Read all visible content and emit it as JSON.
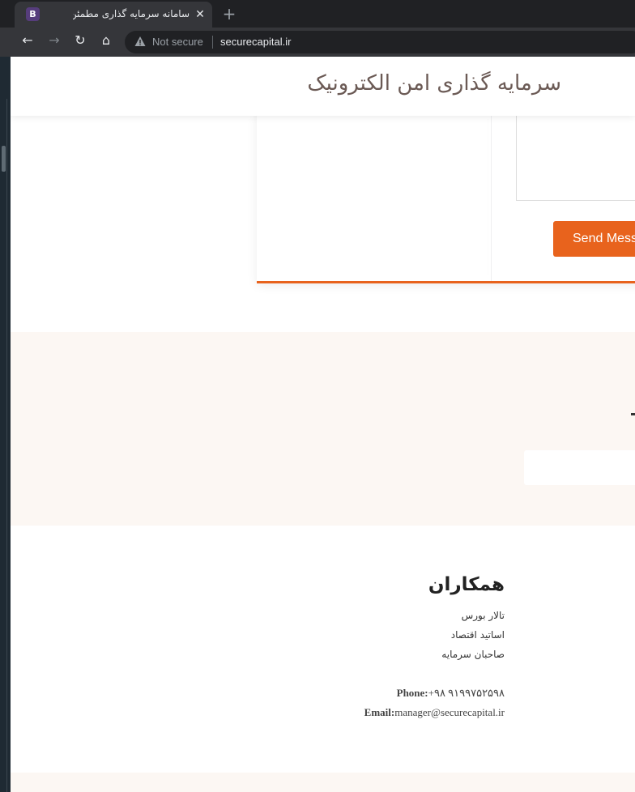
{
  "browser": {
    "tab_favicon_letter": "B",
    "tab_title": "سامانه سرمایه گذاری مطمئن",
    "tab_close": "✕",
    "new_tab": "+",
    "security_label": "Not secure",
    "url": "securecapital.ir",
    "nav": {
      "back": "←",
      "forward": "→",
      "reload": "↻",
      "home": "⌂"
    }
  },
  "site": {
    "title": "سرمایه گذاری امن الکترونیک"
  },
  "contact_form": {
    "send_label": "Send Mess"
  },
  "footer": {
    "heading": "همکاران",
    "links": [
      "تالار بورس",
      "اساتید اقتصاد",
      "صاحبان سرمایه"
    ],
    "phone_label": "Phone:",
    "phone_value": "+۹۸ ۹۱۹۹۷۵۲۵۹۸",
    "email_label": "Email:",
    "email_value": "manager@securecapital.ir"
  },
  "colors": {
    "accent": "#e8631d",
    "peach_bg": "#fcf7f3",
    "title_color": "#6b5a55"
  }
}
